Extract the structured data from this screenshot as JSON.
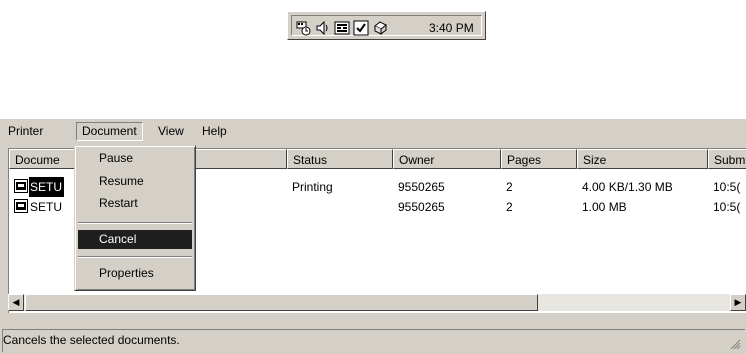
{
  "tray": {
    "icons": [
      "network-adapter-icon",
      "volume-icon",
      "keyboard-layout-icon",
      "security-shield-icon",
      "printer-tray-icon"
    ],
    "clock": "3:40 PM"
  },
  "menubar": {
    "items": [
      {
        "label": "Printer"
      },
      {
        "label": "Document"
      },
      {
        "label": "View"
      },
      {
        "label": "Help"
      }
    ]
  },
  "document_menu": {
    "items": [
      {
        "label": "Pause"
      },
      {
        "label": "Resume"
      },
      {
        "label": "Restart"
      },
      {
        "label": "Cancel",
        "selected": true
      },
      {
        "label": "Properties"
      }
    ]
  },
  "list": {
    "columns": [
      "Docume",
      "Status",
      "Owner",
      "Pages",
      "Size",
      "Subm"
    ],
    "rows": [
      {
        "document": "SETU",
        "status": "Printing",
        "owner": "9550265",
        "pages": "2",
        "size": "4.00 KB/1.30 MB",
        "submitted": "10:5("
      },
      {
        "document": "SETU",
        "status": "",
        "owner": "9550265",
        "pages": "2",
        "size": "1.00 MB",
        "submitted": "10:5("
      }
    ]
  },
  "statusbar": {
    "text": "Cancels the selected documents."
  },
  "colors": {
    "window_bg": "#d4d0c8",
    "selection_bg": "#1f1f1f",
    "selection_fg": "#ffffff"
  }
}
